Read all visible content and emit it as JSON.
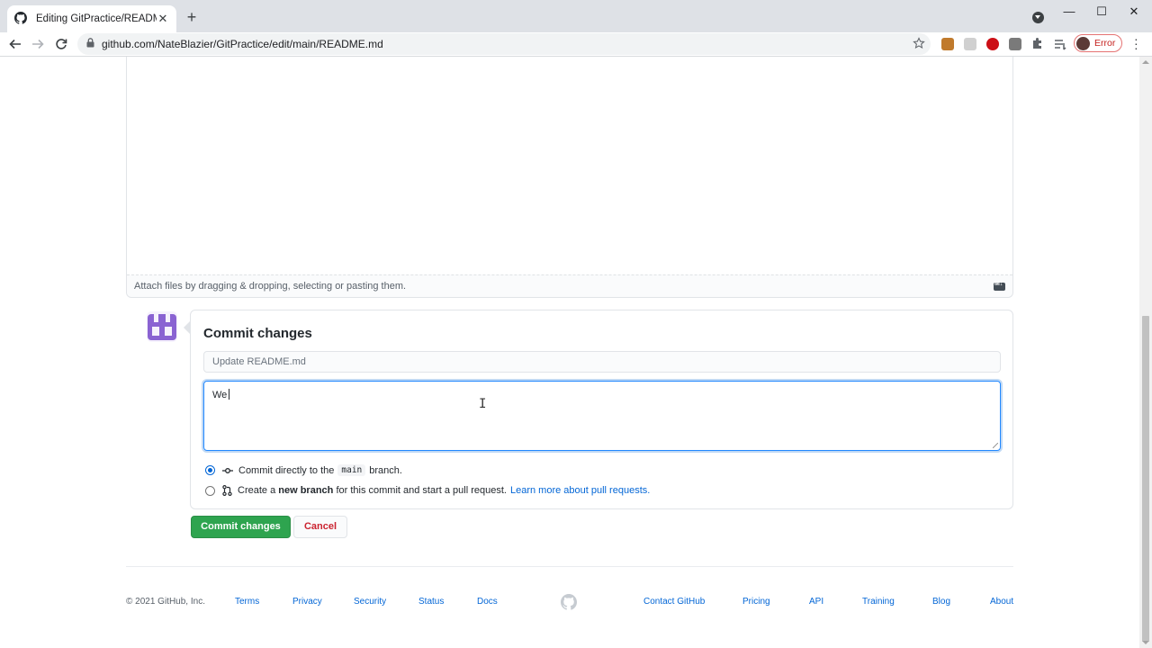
{
  "browser": {
    "tab_title": "Editing GitPractice/README.md a",
    "url": "github.com/NateBlazier/GitPractice/edit/main/README.md",
    "profile_status": "Error"
  },
  "editor": {
    "attach_hint": "Attach files by dragging & dropping, selecting or pasting them."
  },
  "commit": {
    "title": "Commit changes",
    "summary_placeholder": "Update README.md",
    "description_value": "We",
    "option_direct_prefix": "Commit directly to the",
    "option_direct_branch": "main",
    "option_direct_suffix": "branch.",
    "option_new_prefix": "Create a",
    "option_new_bold": "new branch",
    "option_new_suffix": "for this commit and start a pull request.",
    "option_new_link": "Learn more about pull requests.",
    "selected_option": "direct",
    "submit_label": "Commit changes",
    "cancel_label": "Cancel"
  },
  "footer": {
    "copyright": "© 2021 GitHub, Inc.",
    "links": [
      "Terms",
      "Privacy",
      "Security",
      "Status",
      "Docs",
      "Contact GitHub",
      "Pricing",
      "API",
      "Training",
      "Blog",
      "About"
    ]
  },
  "colors": {
    "accent": "#0366d6",
    "commit_button": "#2ea44f",
    "cancel_text": "#cb2431",
    "avatar": "#8a63d2"
  }
}
